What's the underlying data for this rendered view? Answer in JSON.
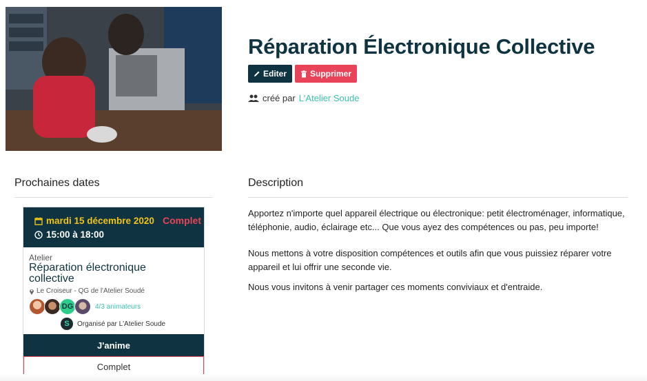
{
  "page": {
    "title": "Réparation Électronique Collective",
    "edit_label": "Editer",
    "delete_label": "Supprimer",
    "created_prefix": "créé par",
    "creator_name": "L'Atelier Soude"
  },
  "sections": {
    "dates_title": "Prochaines dates",
    "description_title": "Description"
  },
  "card": {
    "date": "mardi 15 décembre 2020",
    "time": "15:00 à 18:00",
    "status": "Complet",
    "kind": "Atelier",
    "name": "Réparation électronique collective",
    "location": "Le Croiseur - QG de l'Atelier Soudé",
    "avatar_initials": "DG",
    "animators": "4/3 animateurs",
    "organizer": "Organisé par L'Atelier Soude",
    "organizer_logo": "S",
    "animate_button": "J'anime",
    "full_button": "Complet"
  },
  "description": {
    "p1": "Apportez n'importe quel appareil électrique ou électronique: petit  électroménager, informatique, téléphonie, audio, éclairage etc... Que vous ayez des  compétences ou pas, peu importe!",
    "p2": "Nous mettons à votre disposition compétences et outils afin que vous puissiez réparer votre appareil et lui offrir une seconde vie.",
    "p3": "Nous vous invitons à venir partager ces moments conviviaux et d'entraide."
  },
  "icons": {
    "edit": "pencil-icon",
    "delete": "trash-icon",
    "creator": "users-icon",
    "date": "calendar-icon",
    "time": "clock-icon",
    "location": "map-marker-icon"
  },
  "colors": {
    "primary": "#0f3340",
    "danger": "#e84359",
    "accent": "#3cbfae",
    "date_highlight": "#f0c419"
  }
}
